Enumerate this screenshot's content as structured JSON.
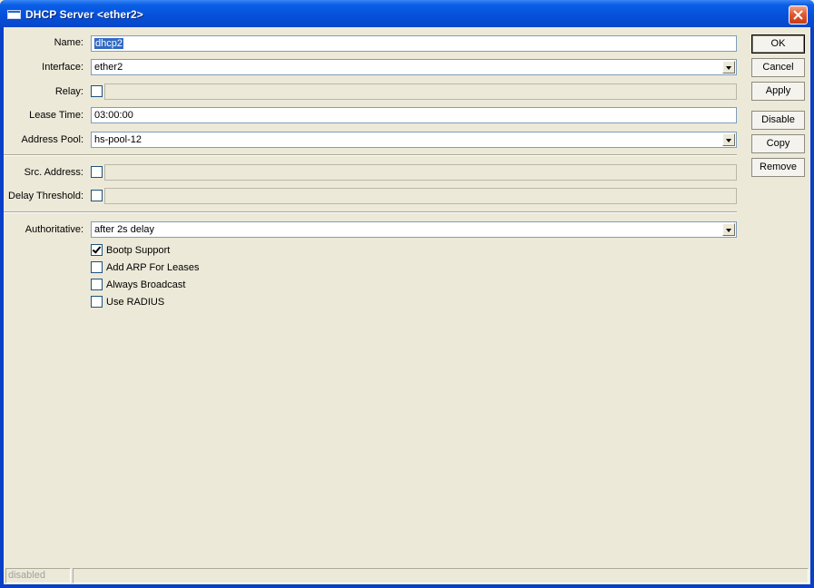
{
  "window": {
    "title": "DHCP Server <ether2>"
  },
  "form": {
    "name": {
      "label": "Name:",
      "value": "dhcp2"
    },
    "interface": {
      "label": "Interface:",
      "value": "ether2"
    },
    "relay": {
      "label": "Relay:",
      "value": ""
    },
    "lease_time": {
      "label": "Lease Time:",
      "value": "03:00:00"
    },
    "address_pool": {
      "label": "Address Pool:",
      "value": "hs-pool-12"
    },
    "src_address": {
      "label": "Src. Address:",
      "value": ""
    },
    "delay_threshold": {
      "label": "Delay Threshold:",
      "value": ""
    },
    "authoritative": {
      "label": "Authoritative:",
      "value": "after 2s delay"
    },
    "options": [
      {
        "label": "Bootp Support",
        "checked": true
      },
      {
        "label": "Add ARP For Leases",
        "checked": false
      },
      {
        "label": "Always Broadcast",
        "checked": false
      },
      {
        "label": "Use RADIUS",
        "checked": false
      }
    ]
  },
  "buttons": {
    "ok": "OK",
    "cancel": "Cancel",
    "apply": "Apply",
    "disable": "Disable",
    "copy": "Copy",
    "remove": "Remove"
  },
  "status": {
    "state": "disabled",
    "message": ""
  },
  "icons": {
    "window": "window-icon",
    "close": "close-icon",
    "dropdown": "chevron-down-icon"
  },
  "colors": {
    "titlebar": "#0551dc",
    "selection": "#316ac5",
    "close": "#e05a32"
  }
}
